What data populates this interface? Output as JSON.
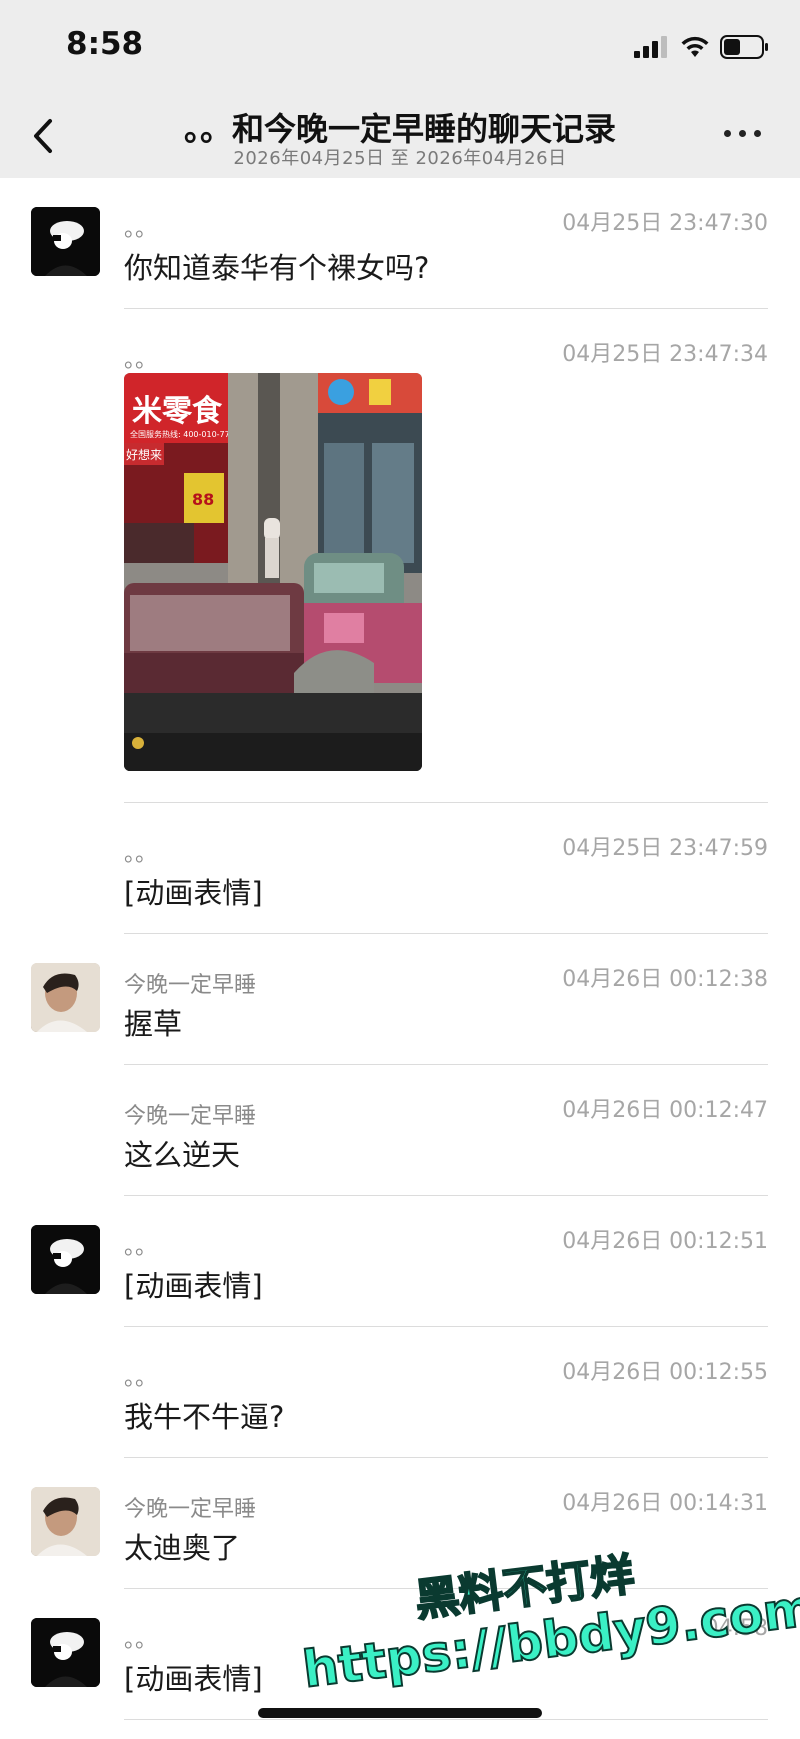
{
  "status": {
    "time": "8:58"
  },
  "header": {
    "title": "。。和今晚一定早睡的聊天记录",
    "subtitle": "2026年04月25日 至 2026年04月26日"
  },
  "messages": [
    {
      "sender": "。。",
      "time": "04月25日 23:47:30",
      "text": "你知道泰华有个裸女吗?"
    },
    {
      "sender": "。。",
      "time": "04月25日 23:47:34",
      "text": ""
    },
    {
      "sender": "。。",
      "time": "04月25日 23:47:59",
      "text": "[动画表情]"
    },
    {
      "sender": "今晚一定早睡",
      "time": "04月26日 00:12:38",
      "text": "握草"
    },
    {
      "sender": "今晚一定早睡",
      "time": "04月26日 00:12:47",
      "text": "这么逆天"
    },
    {
      "sender": "。。",
      "time": "04月26日 00:12:51",
      "text": "[动画表情]"
    },
    {
      "sender": "。。",
      "time": "04月26日 00:12:55",
      "text": "我牛不牛逼?"
    },
    {
      "sender": "今晚一定早睡",
      "time": "04月26日 00:14:31",
      "text": "太迪奥了"
    },
    {
      "sender": "。。",
      "time": "04:58",
      "text": "[动画表情]"
    }
  ],
  "photo": {
    "sign_text": "米零食",
    "phone_text": "全国服务热线: 400-010-7777",
    "shop_text": "好想来",
    "price_text": "88"
  },
  "watermark": {
    "line1": "黑料不打烊",
    "line2": "https://bbdy9.com"
  },
  "colors": {
    "bar_bg": "#ededed",
    "watermark": "#3af0c5"
  }
}
